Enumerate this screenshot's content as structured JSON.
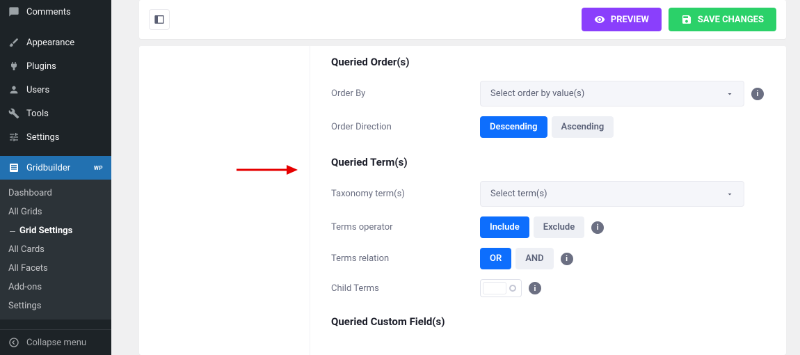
{
  "sidebar": {
    "items": [
      {
        "label": "Comments"
      },
      {
        "label": "Appearance"
      },
      {
        "label": "Plugins"
      },
      {
        "label": "Users"
      },
      {
        "label": "Tools"
      },
      {
        "label": "Settings"
      }
    ],
    "active": {
      "label": "Gridbuilder",
      "badge": "WP"
    },
    "subitems": [
      {
        "label": "Dashboard"
      },
      {
        "label": "All Grids"
      },
      {
        "label": "Grid Settings"
      },
      {
        "label": "All Cards"
      },
      {
        "label": "All Facets"
      },
      {
        "label": "Add-ons"
      },
      {
        "label": "Settings"
      }
    ],
    "collapse": "Collapse menu"
  },
  "topbar": {
    "preview": "PREVIEW",
    "save": "SAVE CHANGES"
  },
  "sections": {
    "order": {
      "title": "Queried Order(s)",
      "order_by_label": "Order By",
      "order_by_placeholder": "Select order by value(s)",
      "direction_label": "Order Direction",
      "direction_options": {
        "desc": "Descending",
        "asc": "Ascending"
      },
      "direction_value": "desc"
    },
    "terms": {
      "title": "Queried Term(s)",
      "taxonomy_label": "Taxonomy term(s)",
      "taxonomy_placeholder": "Select term(s)",
      "operator_label": "Terms operator",
      "operator_options": {
        "include": "Include",
        "exclude": "Exclude"
      },
      "operator_value": "include",
      "relation_label": "Terms relation",
      "relation_options": {
        "or": "OR",
        "and": "AND"
      },
      "relation_value": "or",
      "child_label": "Child Terms"
    },
    "custom": {
      "title": "Queried Custom Field(s)"
    }
  }
}
